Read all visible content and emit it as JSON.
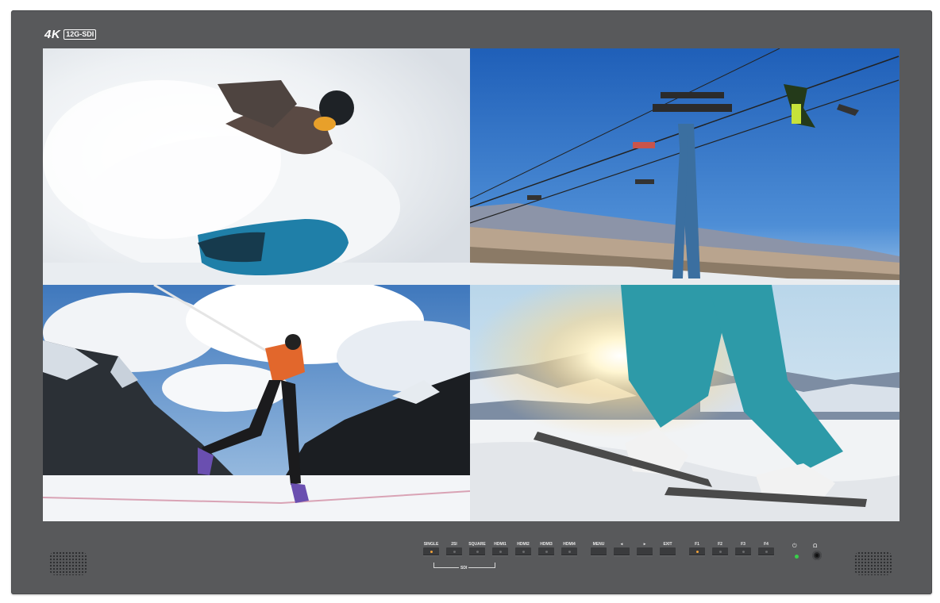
{
  "brand": {
    "resolution": "4K",
    "interface": "12G-SDI"
  },
  "screen": {
    "layout": "quad-view",
    "quadrants": [
      {
        "id": "top-left",
        "scene": "snowboarder"
      },
      {
        "id": "top-right",
        "scene": "ski-lift"
      },
      {
        "id": "bottom-left",
        "scene": "cross-country-skier"
      },
      {
        "id": "bottom-right",
        "scene": "ski-boots-sunburst"
      }
    ]
  },
  "controls": {
    "buttons": [
      {
        "label": "SINGLE",
        "led": "orange"
      },
      {
        "label": "2SI",
        "led": "off"
      },
      {
        "label": "SQUARE",
        "led": "off"
      },
      {
        "label": "HDMI1",
        "led": "off"
      },
      {
        "label": "HDMI2",
        "led": "off"
      },
      {
        "label": "HDMI3",
        "led": "off"
      },
      {
        "label": "HDMI4",
        "led": "off"
      },
      {
        "label": "MENU",
        "led": "none"
      },
      {
        "label": "◂",
        "led": "none"
      },
      {
        "label": "▸",
        "led": "none"
      },
      {
        "label": "EXIT",
        "led": "none"
      },
      {
        "label": "F1",
        "led": "orange"
      },
      {
        "label": "F2",
        "led": "off"
      },
      {
        "label": "F3",
        "led": "off"
      },
      {
        "label": "F4",
        "led": "off"
      }
    ],
    "sdi_group_label": "SDI",
    "power_symbol": "⏻",
    "headphone_symbol": "Ω",
    "power_led_color": "#38d04a"
  }
}
